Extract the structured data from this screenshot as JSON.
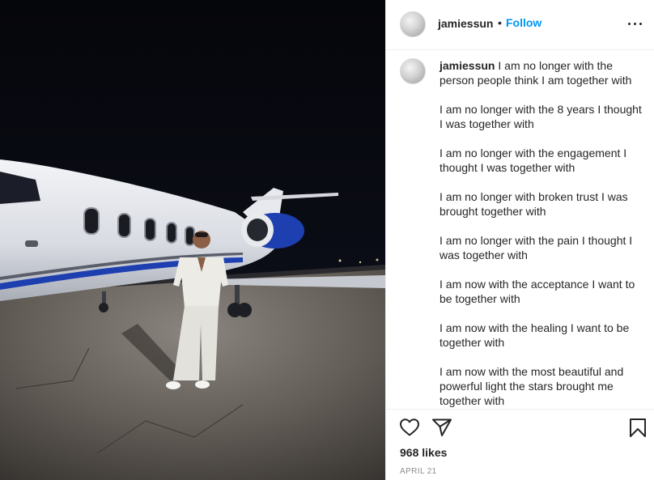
{
  "post": {
    "author": "jamiessun",
    "separator": "•",
    "follow_label": "Follow",
    "caption_paragraphs": [
      "I am no longer with the person people think I am together with",
      "I am no longer with the 8 years I thought I was together with",
      "I am no longer with the engagement I thought I was together with",
      "I am no longer with broken trust I was brought together with",
      "I am no longer with the pain I thought I was together with",
      "I am now with the acceptance I want to be together with",
      "I am now with the healing I want to be together with",
      "I am now with the most beautiful and powerful light the stars brought me together with"
    ],
    "likes": "968 likes",
    "date": "APRIL 21"
  },
  "icons": {
    "more": "more-options-icon",
    "like": "heart-icon",
    "share": "paper-plane-icon",
    "save": "bookmark-icon"
  },
  "colors": {
    "follow": "#0095f6",
    "text": "#262626",
    "muted": "#8e8e8e",
    "divider": "#efefef"
  }
}
